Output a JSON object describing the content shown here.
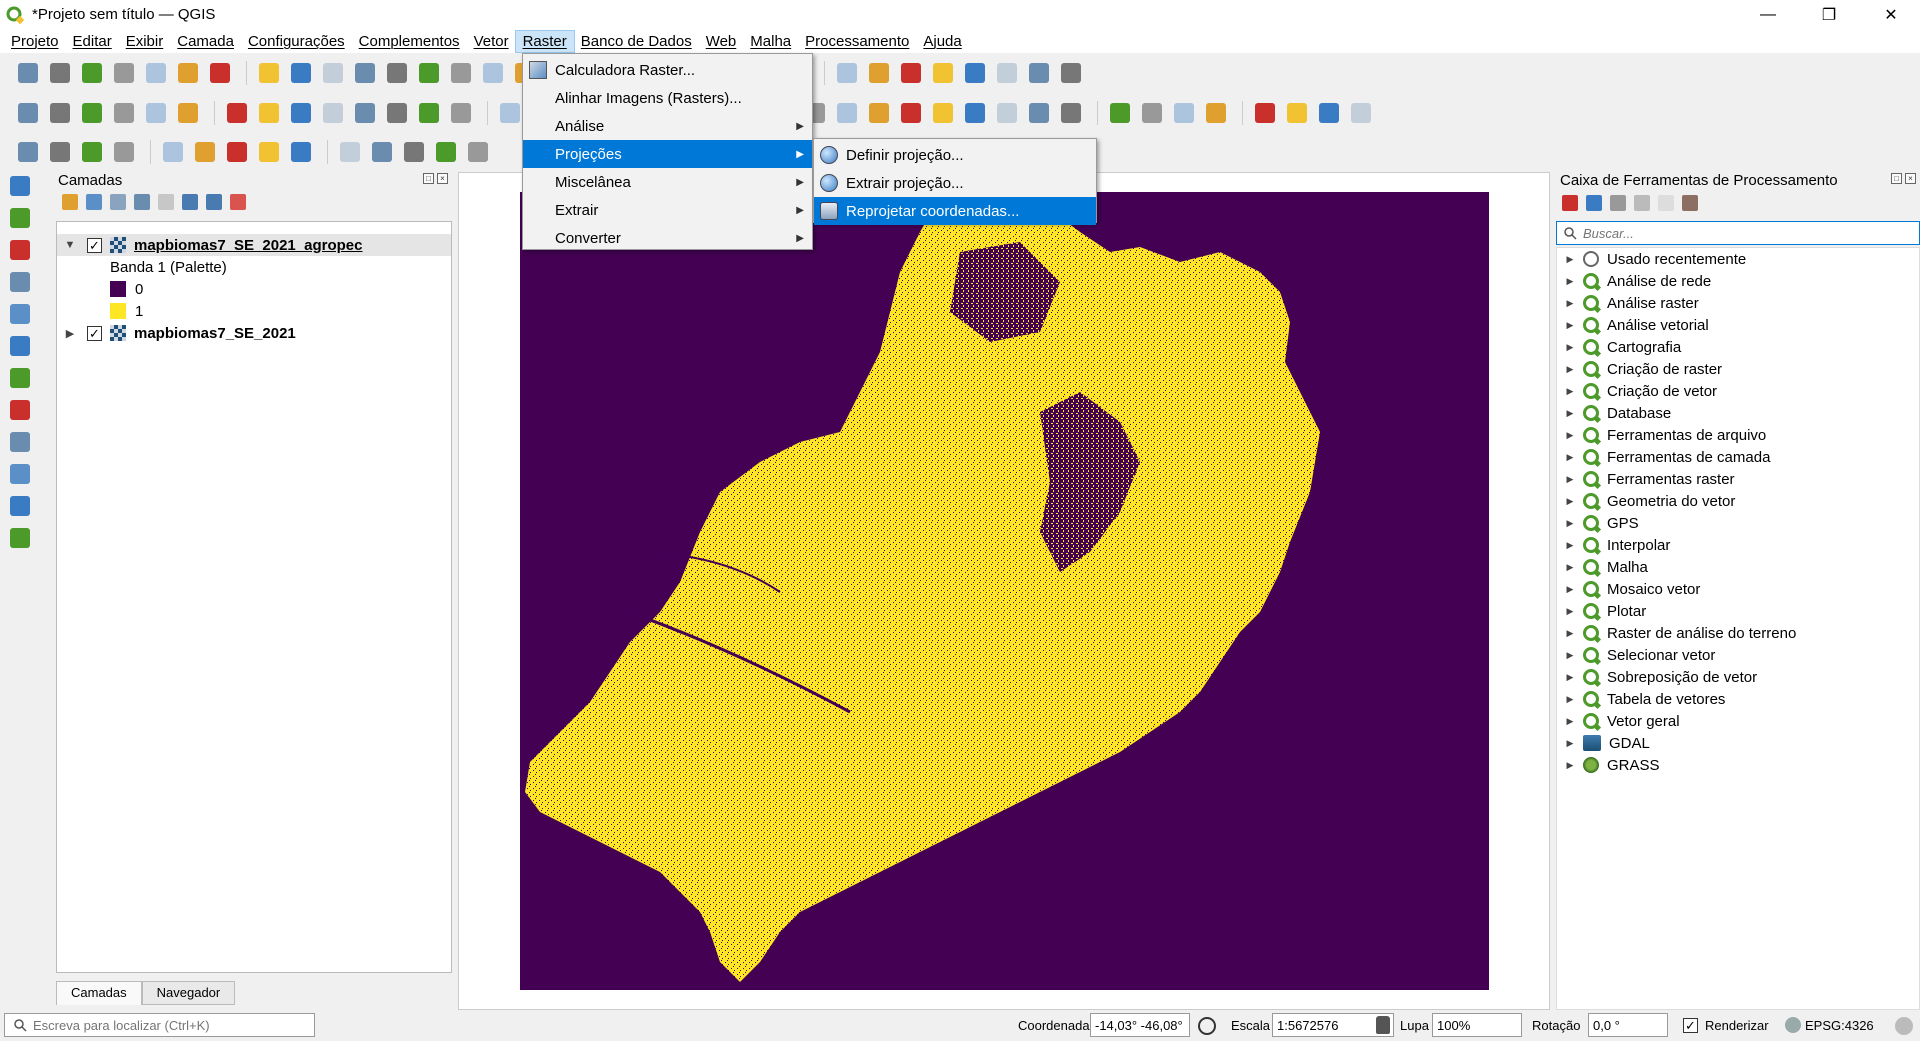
{
  "window": {
    "title": "*Projeto sem título — QGIS",
    "controls": [
      "minimize-icon",
      "restore-icon",
      "close-icon"
    ]
  },
  "menubar": [
    "Projeto",
    "Editar",
    "Exibir",
    "Camada",
    "Configurações",
    "Complementos",
    "Vetor",
    "Raster",
    "Banco de Dados",
    "Web",
    "Malha",
    "Processamento",
    "Ajuda"
  ],
  "active_menu": "Raster",
  "raster_menu": [
    {
      "label": "Calculadora Raster...",
      "icon": "raster-calculator-icon",
      "submenu": false
    },
    {
      "label": "Alinhar Imagens (Rasters)...",
      "icon": "",
      "submenu": false
    },
    {
      "label": "Análise",
      "icon": "",
      "submenu": true
    },
    {
      "label": "Projeções",
      "icon": "",
      "submenu": true,
      "highlighted": true
    },
    {
      "label": "Miscelânea",
      "icon": "",
      "submenu": true
    },
    {
      "label": "Extrair",
      "icon": "",
      "submenu": true
    },
    {
      "label": "Converter",
      "icon": "",
      "submenu": true
    }
  ],
  "projections_submenu": [
    {
      "label": "Definir projeção...",
      "icon": "globe-icon"
    },
    {
      "label": "Extrair projeção...",
      "icon": "globe-icon"
    },
    {
      "label": "Reprojetar coordenadas...",
      "icon": "reproject-icon",
      "highlighted": true
    }
  ],
  "layers_panel": {
    "title": "Camadas",
    "layers": [
      {
        "name": "mapbiomas7_SE_2021_agropec",
        "checked": true,
        "expanded": true,
        "selected": true,
        "legend_title": "Banda 1 (Palette)",
        "legend": [
          {
            "label": "0",
            "color": "#440154"
          },
          {
            "label": "1",
            "color": "#fde725"
          }
        ]
      },
      {
        "name": "mapbiomas7_SE_2021",
        "checked": true,
        "expanded": false,
        "selected": false
      }
    ],
    "tabs": [
      "Camadas",
      "Navegador"
    ],
    "active_tab": "Camadas"
  },
  "toolbox": {
    "title": "Caixa de Ferramentas de Processamento",
    "search_placeholder": "Buscar...",
    "groups": [
      {
        "label": "Usado recentemente",
        "icon": "clock-icon"
      },
      {
        "label": "Análise de rede",
        "icon": "qgis-icon"
      },
      {
        "label": "Análise raster",
        "icon": "qgis-icon"
      },
      {
        "label": "Análise vetorial",
        "icon": "qgis-icon"
      },
      {
        "label": "Cartografia",
        "icon": "qgis-icon"
      },
      {
        "label": "Criação de raster",
        "icon": "qgis-icon"
      },
      {
        "label": "Criação de vetor",
        "icon": "qgis-icon"
      },
      {
        "label": "Database",
        "icon": "qgis-icon"
      },
      {
        "label": "Ferramentas de arquivo",
        "icon": "qgis-icon"
      },
      {
        "label": "Ferramentas de camada",
        "icon": "qgis-icon"
      },
      {
        "label": "Ferramentas raster",
        "icon": "qgis-icon"
      },
      {
        "label": "Geometria do vetor",
        "icon": "qgis-icon"
      },
      {
        "label": "GPS",
        "icon": "qgis-icon"
      },
      {
        "label": "Interpolar",
        "icon": "qgis-icon"
      },
      {
        "label": "Malha",
        "icon": "qgis-icon"
      },
      {
        "label": "Mosaico vetor",
        "icon": "qgis-icon"
      },
      {
        "label": "Plotar",
        "icon": "qgis-icon"
      },
      {
        "label": "Raster de análise do terreno",
        "icon": "qgis-icon"
      },
      {
        "label": "Selecionar vetor",
        "icon": "qgis-icon"
      },
      {
        "label": "Sobreposição de vetor",
        "icon": "qgis-icon"
      },
      {
        "label": "Tabela de vetores",
        "icon": "qgis-icon"
      },
      {
        "label": "Vetor geral",
        "icon": "qgis-icon"
      },
      {
        "label": "GDAL",
        "icon": "gdal-icon"
      },
      {
        "label": "GRASS",
        "icon": "grass-icon"
      }
    ]
  },
  "map": {
    "background": "#440154",
    "foreground": "#fde725"
  },
  "statusbar": {
    "locator_placeholder": "Escreva para localizar (Ctrl+K)",
    "coord_label": "Coordenada",
    "coord_value": "-14,03° -46,08°",
    "scale_label": "Escala",
    "scale_value": "1:5672576",
    "magnifier_label": "Lupa",
    "magnifier_value": "100%",
    "rotation_label": "Rotação",
    "rotation_value": "0,0 °",
    "render_label": "Renderizar",
    "render_checked": true,
    "crs": "EPSG:4326"
  }
}
